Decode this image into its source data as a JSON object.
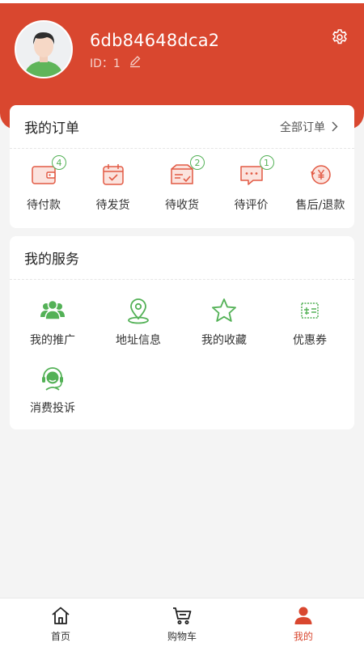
{
  "profile": {
    "username": "6db84648dca2",
    "id_label": "ID：1"
  },
  "orders": {
    "title": "我的订单",
    "all_label": "全部订单",
    "items": [
      {
        "label": "待付款",
        "badge": "4",
        "icon": "wallet-icon"
      },
      {
        "label": "待发货",
        "badge": "",
        "icon": "calendar-icon"
      },
      {
        "label": "待收货",
        "badge": "2",
        "icon": "delivery-box-icon"
      },
      {
        "label": "待评价",
        "badge": "1",
        "icon": "comment-icon"
      },
      {
        "label": "售后/退款",
        "badge": "",
        "icon": "refund-icon"
      }
    ]
  },
  "services": {
    "title": "我的服务",
    "items": [
      {
        "label": "我的推广",
        "icon": "users-icon"
      },
      {
        "label": "地址信息",
        "icon": "location-pin-icon"
      },
      {
        "label": "我的收藏",
        "icon": "star-icon"
      },
      {
        "label": "优惠券",
        "icon": "coupon-icon"
      },
      {
        "label": "消费投诉",
        "icon": "headset-icon"
      }
    ]
  },
  "tabbar": {
    "items": [
      {
        "label": "首页",
        "icon": "home-icon",
        "active": false
      },
      {
        "label": "购物车",
        "icon": "cart-icon",
        "active": false
      },
      {
        "label": "我的",
        "icon": "user-icon",
        "active": true
      }
    ]
  },
  "colors": {
    "brand": "#d9472f",
    "accent_green": "#53b156",
    "background": "#f4f4f4"
  }
}
